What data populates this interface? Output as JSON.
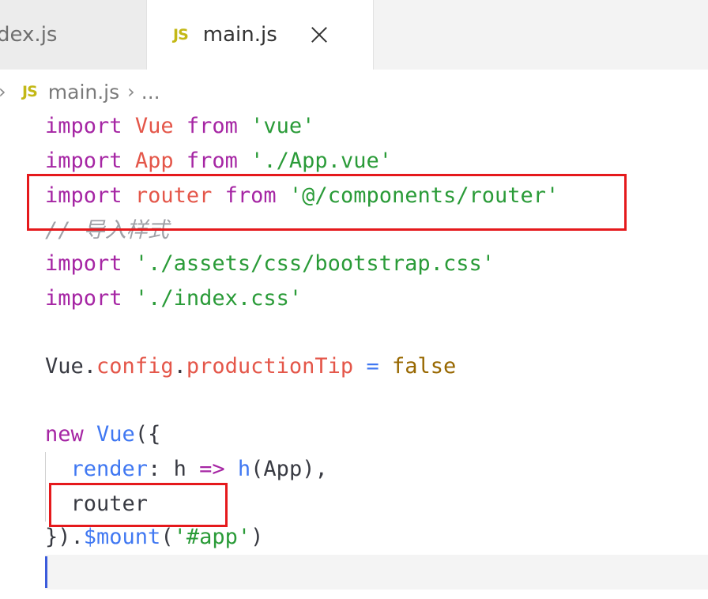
{
  "tabs": [
    {
      "label": "dex.js",
      "active": false
    },
    {
      "label": "main.js",
      "active": true,
      "icon": "JS"
    }
  ],
  "breadcrumb": {
    "icon": "JS",
    "file": "main.js",
    "ellipsis": "..."
  },
  "code": {
    "l1": {
      "kw": "import",
      "id": "Vue",
      "from": "from",
      "str": "'vue'"
    },
    "l2": {
      "kw": "import",
      "id": "App",
      "from": "from",
      "str": "'./App.vue'"
    },
    "l3": {
      "kw": "import",
      "id": "router",
      "from": "from",
      "str": "'@/components/router'"
    },
    "l4": {
      "comment": "// 导入样式"
    },
    "l5": {
      "kw": "import",
      "str": "'./assets/css/bootstrap.css'"
    },
    "l6": {
      "kw": "import",
      "str": "'./index.css'"
    },
    "l8": {
      "obj": "Vue",
      "dot1": ".",
      "p1": "config",
      "dot2": ".",
      "p2": "productionTip",
      "eq": "=",
      "val": "false"
    },
    "l10": {
      "kw": "new",
      "fn": "Vue",
      "rest": "({"
    },
    "l11": {
      "key": "render",
      "colon": ":",
      "param": "h",
      "arrow": "=>",
      "fn": "h",
      "args": "(App),"
    },
    "l12": {
      "text": "router"
    },
    "l13": {
      "close": "}).",
      "fn": "$mount",
      "open": "(",
      "str": "'#app'",
      "end": ")"
    }
  },
  "colors": {
    "keyword": "#a626a4",
    "identifier": "#e45649",
    "string": "#2a9b38",
    "comment": "#a0a1a7",
    "function": "#4078f2",
    "boolean": "#986801",
    "annotation_box": "#e5191c",
    "js_icon": "#c3b816"
  }
}
